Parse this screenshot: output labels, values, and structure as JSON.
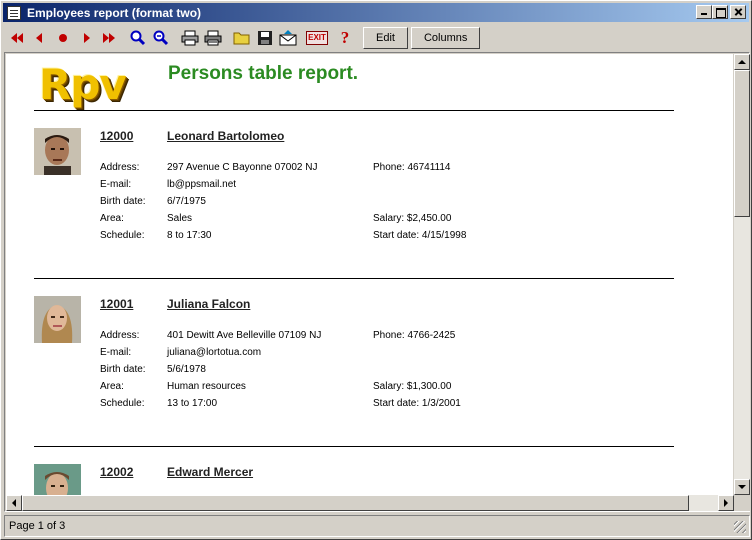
{
  "window": {
    "title": "Employees report (format two)"
  },
  "toolbar": {
    "nav_icons": [
      "first-page-icon",
      "previous-page-icon",
      "stop-icon",
      "next-page-icon",
      "last-page-icon"
    ],
    "zoom_icons": [
      "zoom-in-icon",
      "zoom-out-icon"
    ],
    "edit_label": "Edit",
    "columns_label": "Columns",
    "exit_label": "EXIT",
    "help_label": "?"
  },
  "report": {
    "logo_text": "Rpv",
    "title": "Persons table report.",
    "labels": {
      "address": "Address:",
      "email": "E-mail:",
      "birth": "Birth date:",
      "area": "Area:",
      "schedule": "Schedule:"
    },
    "employees": [
      {
        "id": "12000",
        "name": "Leonard Bartolomeo",
        "address": "297 Avenue C Bayonne 07002 NJ",
        "phone": "Phone: 46741114",
        "email": "lb@ppsmail.net",
        "birth": "6/7/1975",
        "area": "Sales",
        "salary": "Salary: $2,450.00",
        "schedule": "8 to 17:30",
        "start": "Start date: 4/15/1998"
      },
      {
        "id": "12001",
        "name": "Juliana Falcon",
        "address": "401 Dewitt Ave Belleville 07109 NJ",
        "phone": "Phone: 4766-2425",
        "email": "juliana@lortotua.com",
        "birth": "5/6/1978",
        "area": "Human resources",
        "salary": "Salary: $1,300.00",
        "schedule": "13 to 17:00",
        "start": "Start date: 1/3/2001"
      },
      {
        "id": "12002",
        "name": "Edward Mercer"
      }
    ]
  },
  "status": {
    "page": "Page 1 of 3"
  },
  "colors": {
    "title_bar": "#0a246a",
    "report_title": "#2b8b22",
    "nav_arrows": "#c00000",
    "zoom": "#0000c0"
  }
}
